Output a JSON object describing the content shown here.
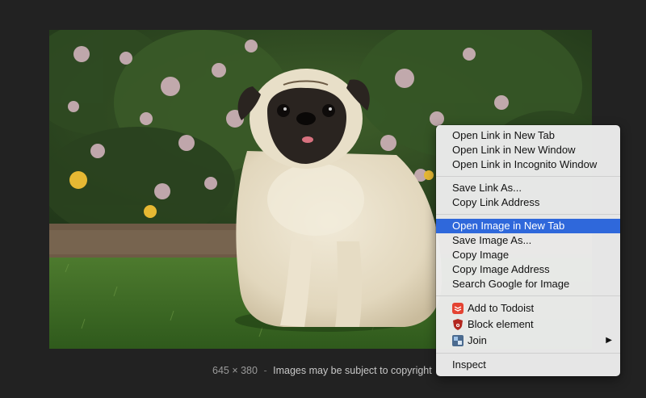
{
  "caption": {
    "dimensions": "645 × 380",
    "separator": "-",
    "notice": "Images may be subject to copyright"
  },
  "context_menu": {
    "items": [
      {
        "label": "Open Link in New Tab"
      },
      {
        "label": "Open Link in New Window"
      },
      {
        "label": "Open Link in Incognito Window"
      },
      {
        "label": "Save Link As..."
      },
      {
        "label": "Copy Link Address"
      },
      {
        "label": "Open Image in New Tab",
        "highlighted": true
      },
      {
        "label": "Save Image As..."
      },
      {
        "label": "Copy Image"
      },
      {
        "label": "Copy Image Address"
      },
      {
        "label": "Search Google for Image"
      },
      {
        "label": "Add to Todoist",
        "icon": "todoist-icon"
      },
      {
        "label": "Block element",
        "icon": "ublock-icon"
      },
      {
        "label": "Join",
        "icon": "join-icon",
        "submenu_arrow": "▶"
      },
      {
        "label": "Inspect"
      }
    ]
  },
  "colors": {
    "background": "#222222",
    "menu_highlight": "#2f68db",
    "menu_background": "#ececec"
  }
}
